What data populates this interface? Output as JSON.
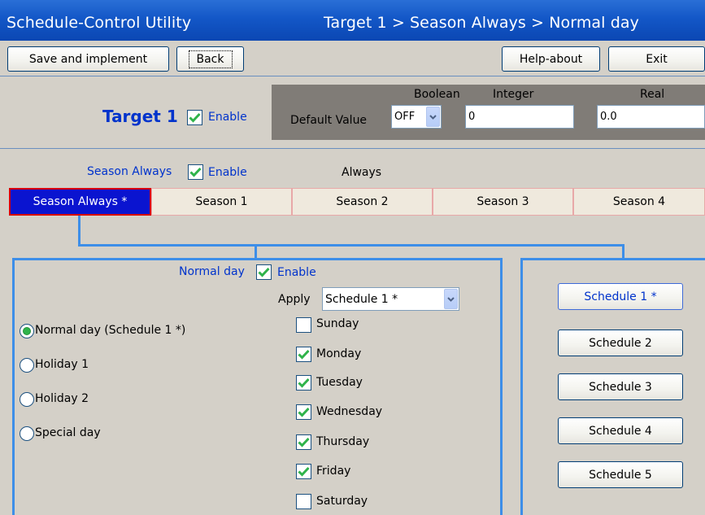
{
  "title": {
    "app": "Schedule-Control Utility",
    "breadcrumb": "Target 1 > Season Always > Normal day"
  },
  "toolbar": {
    "save": "Save and implement",
    "back": "Back",
    "help": "Help-about",
    "exit": "Exit"
  },
  "target": {
    "name": "Target 1",
    "enable_label": "Enable",
    "enabled": true
  },
  "defaults": {
    "label": "Default Value",
    "boolean_header": "Boolean",
    "integer_header": "Integer",
    "real_header": "Real",
    "boolean_value": "OFF",
    "integer_value": "0",
    "real_value": "0.0"
  },
  "season": {
    "label": "Season Always",
    "enable_label": "Enable",
    "enabled": true,
    "mode": "Always"
  },
  "tabs": [
    {
      "label": "Season Always *",
      "active": true
    },
    {
      "label": "Season 1",
      "active": false
    },
    {
      "label": "Season 2",
      "active": false
    },
    {
      "label": "Season 3",
      "active": false
    },
    {
      "label": "Season 4",
      "active": false
    }
  ],
  "day": {
    "label": "Normal day",
    "enable_label": "Enable",
    "enabled": true,
    "apply_label": "Apply",
    "apply_value": "Schedule 1 *"
  },
  "day_types": [
    {
      "label": "Normal day (Schedule 1 *)",
      "selected": true
    },
    {
      "label": "Holiday 1",
      "selected": false
    },
    {
      "label": "Holiday 2",
      "selected": false
    },
    {
      "label": "Special day",
      "selected": false
    }
  ],
  "weekdays": [
    {
      "label": "Sunday",
      "checked": false
    },
    {
      "label": "Monday",
      "checked": true
    },
    {
      "label": "Tuesday",
      "checked": true
    },
    {
      "label": "Wednesday",
      "checked": true
    },
    {
      "label": "Thursday",
      "checked": true
    },
    {
      "label": "Friday",
      "checked": true
    },
    {
      "label": "Saturday",
      "checked": false
    }
  ],
  "schedules": [
    {
      "label": "Schedule 1 *",
      "active": true
    },
    {
      "label": "Schedule 2",
      "active": false
    },
    {
      "label": "Schedule 3",
      "active": false
    },
    {
      "label": "Schedule 4",
      "active": false
    },
    {
      "label": "Schedule 5",
      "active": false
    }
  ],
  "colors": {
    "title_bar": "#1357c7",
    "accent_blue": "#0033cc",
    "active_tab": "#0a14d0",
    "tab_border_active": "#d80000",
    "panel_border": "#3d8ee8",
    "check_green": "#2fb34a"
  }
}
